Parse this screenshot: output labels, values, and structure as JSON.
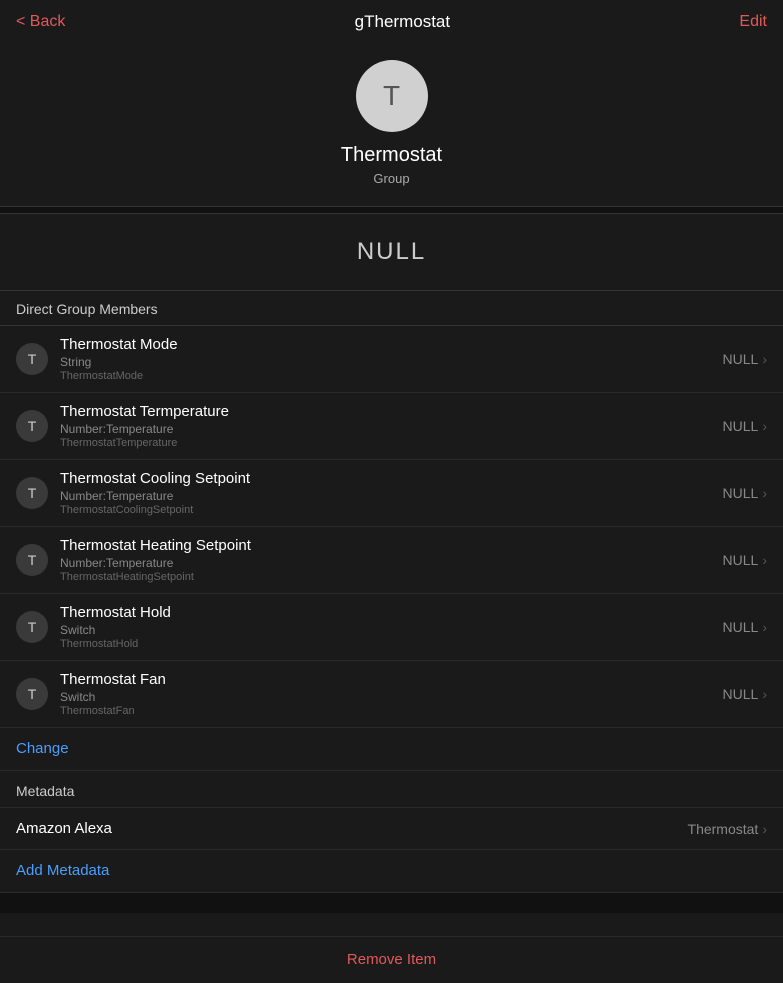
{
  "header": {
    "back_label": "< Back",
    "title": "gThermostat",
    "edit_label": "Edit"
  },
  "avatar": {
    "letter": "T",
    "name": "Thermostat",
    "subtitle": "Group"
  },
  "null_display": {
    "value": "NULL"
  },
  "direct_group_members": {
    "section_title": "Direct Group Members",
    "items": [
      {
        "icon_letter": "T",
        "name": "Thermostat Mode",
        "type": "String",
        "tag": "ThermostatMode",
        "value": "NULL"
      },
      {
        "icon_letter": "T",
        "name": "Thermostat Termperature",
        "type": "Number:Temperature",
        "tag": "ThermostatTemperature",
        "value": "NULL"
      },
      {
        "icon_letter": "T",
        "name": "Thermostat Cooling Setpoint",
        "type": "Number:Temperature",
        "tag": "ThermostatCoolingSetpoint",
        "value": "NULL"
      },
      {
        "icon_letter": "T",
        "name": "Thermostat Heating Setpoint",
        "type": "Number:Temperature",
        "tag": "ThermostatHeatingSetpoint",
        "value": "NULL"
      },
      {
        "icon_letter": "T",
        "name": "Thermostat Hold",
        "type": "Switch",
        "tag": "ThermostatHold",
        "value": "NULL"
      },
      {
        "icon_letter": "T",
        "name": "Thermostat Fan",
        "type": "Switch",
        "tag": "ThermostatFan",
        "value": "NULL"
      }
    ],
    "change_label": "Change"
  },
  "metadata": {
    "section_title": "Metadata",
    "items": [
      {
        "label": "Amazon Alexa",
        "value": "Thermostat"
      }
    ],
    "add_label": "Add Metadata"
  },
  "remove": {
    "label": "Remove Item"
  },
  "colors": {
    "accent": "#e05a5a",
    "link": "#4a9eff",
    "bg": "#1a1a1a",
    "text_primary": "#ffffff",
    "text_secondary": "#888888"
  }
}
